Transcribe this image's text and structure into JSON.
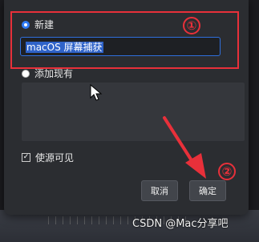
{
  "dialog": {
    "option_new_label": "新建",
    "name_value": "macOS 屏幕捕获",
    "option_existing_label": "添加现有",
    "visible_checkbox_label": "使源可见",
    "visible_checked": true,
    "cancel_label": "取消",
    "confirm_label": "确定"
  },
  "annotations": {
    "step_one": "①",
    "step_two": "②",
    "highlight_color": "#e8303a"
  },
  "watermark": "CSDN @Mac分享吧"
}
